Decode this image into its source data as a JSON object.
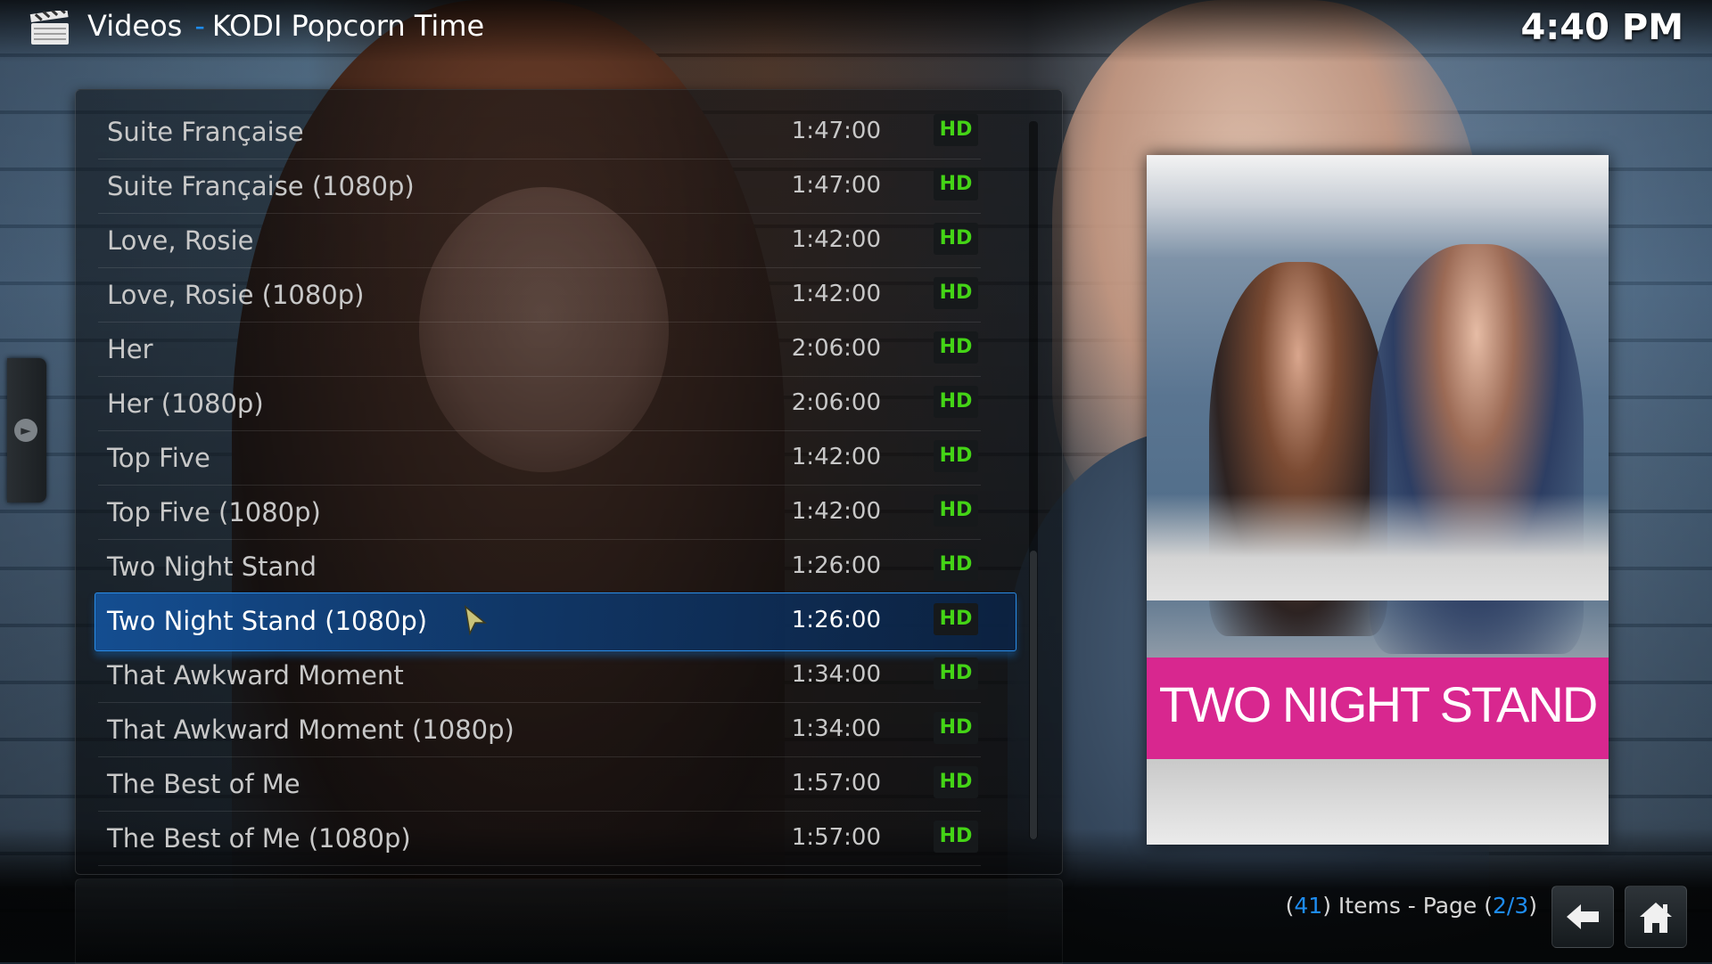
{
  "header": {
    "section": "Videos",
    "separator": "-",
    "addon": "KODI Popcorn Time",
    "clock": "4:40 PM",
    "icon": "clapperboard-icon"
  },
  "list": {
    "items": [
      {
        "name": "Suite Française",
        "duration": "1:47:00",
        "badge": "HD"
      },
      {
        "name": "Suite Française (1080p)",
        "duration": "1:47:00",
        "badge": "HD"
      },
      {
        "name": "Love, Rosie",
        "duration": "1:42:00",
        "badge": "HD"
      },
      {
        "name": "Love, Rosie (1080p)",
        "duration": "1:42:00",
        "badge": "HD"
      },
      {
        "name": "Her",
        "duration": "2:06:00",
        "badge": "HD"
      },
      {
        "name": "Her (1080p)",
        "duration": "2:06:00",
        "badge": "HD"
      },
      {
        "name": "Top Five",
        "duration": "1:42:00",
        "badge": "HD"
      },
      {
        "name": "Top Five (1080p)",
        "duration": "1:42:00",
        "badge": "HD"
      },
      {
        "name": "Two Night Stand",
        "duration": "1:26:00",
        "badge": "HD"
      },
      {
        "name": "Two Night Stand (1080p)",
        "duration": "1:26:00",
        "badge": "HD"
      },
      {
        "name": "That Awkward Moment",
        "duration": "1:34:00",
        "badge": "HD"
      },
      {
        "name": "That Awkward Moment (1080p)",
        "duration": "1:34:00",
        "badge": "HD"
      },
      {
        "name": "The Best of Me",
        "duration": "1:57:00",
        "badge": "HD"
      },
      {
        "name": "The Best of Me (1080p)",
        "duration": "1:57:00",
        "badge": "HD"
      }
    ],
    "selected_index": 9
  },
  "poster": {
    "title": "TWO NIGHT STAND"
  },
  "footer": {
    "open_paren": "(",
    "item_count": "41",
    "items_text": ") Items - Page (",
    "page": "2/3",
    "close_paren": ")"
  },
  "colors": {
    "accent": "#1e8cf0",
    "hd_badge": "#44d416",
    "poster_band": "#d8278f"
  }
}
